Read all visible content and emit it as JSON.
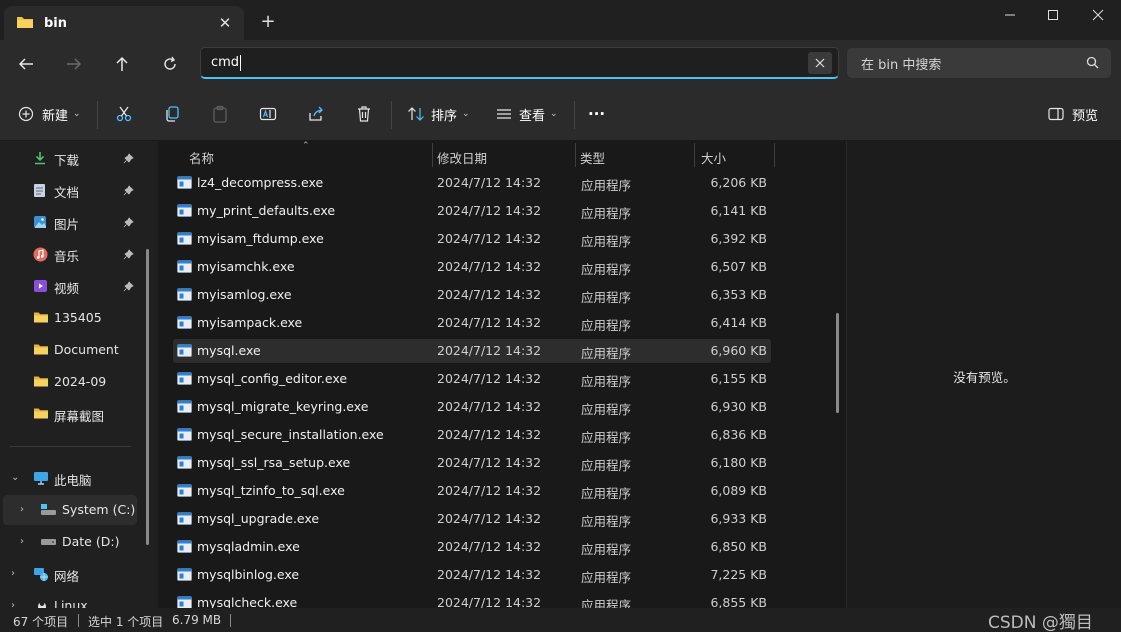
{
  "window": {
    "tab_title": "bin",
    "new_tab_symbol": "+",
    "close_symbol": "✕"
  },
  "address": {
    "value": "cmd",
    "search_placeholder": "在 bin 中搜索"
  },
  "toolbar": {
    "new_label": "新建",
    "sort_label": "排序",
    "view_label": "查看",
    "more_label": "···",
    "preview_label": "预览"
  },
  "sidebar": {
    "items": [
      {
        "label": "下载",
        "icon": "download-icon",
        "pinned": true
      },
      {
        "label": "文档",
        "icon": "document-icon",
        "pinned": true
      },
      {
        "label": "图片",
        "icon": "pictures-icon",
        "pinned": true
      },
      {
        "label": "音乐",
        "icon": "music-icon",
        "pinned": true
      },
      {
        "label": "视频",
        "icon": "videos-icon",
        "pinned": true
      },
      {
        "label": "135405",
        "icon": "folder-icon"
      },
      {
        "label": "Document",
        "icon": "folder-icon"
      },
      {
        "label": "2024-09",
        "icon": "folder-icon"
      },
      {
        "label": "屏幕截图",
        "icon": "folder-icon"
      }
    ],
    "tree": [
      {
        "label": "此电脑",
        "icon": "pc-icon"
      },
      {
        "label": "System (C:)",
        "icon": "drive-icon"
      },
      {
        "label": "Date (D:)",
        "icon": "drive-icon"
      },
      {
        "label": "网络",
        "icon": "network-icon"
      },
      {
        "label": "Linux",
        "icon": "linux-icon"
      }
    ]
  },
  "columns": {
    "name": "名称",
    "date": "修改日期",
    "type": "类型",
    "size": "大小"
  },
  "files": [
    {
      "name": "lz4_decompress.exe",
      "date": "2024/7/12 14:32",
      "type": "应用程序",
      "size": "6,206 KB"
    },
    {
      "name": "my_print_defaults.exe",
      "date": "2024/7/12 14:32",
      "type": "应用程序",
      "size": "6,141 KB"
    },
    {
      "name": "myisam_ftdump.exe",
      "date": "2024/7/12 14:32",
      "type": "应用程序",
      "size": "6,392 KB"
    },
    {
      "name": "myisamchk.exe",
      "date": "2024/7/12 14:32",
      "type": "应用程序",
      "size": "6,507 KB"
    },
    {
      "name": "myisamlog.exe",
      "date": "2024/7/12 14:32",
      "type": "应用程序",
      "size": "6,353 KB"
    },
    {
      "name": "myisampack.exe",
      "date": "2024/7/12 14:32",
      "type": "应用程序",
      "size": "6,414 KB"
    },
    {
      "name": "mysql.exe",
      "date": "2024/7/12 14:32",
      "type": "应用程序",
      "size": "6,960 KB"
    },
    {
      "name": "mysql_config_editor.exe",
      "date": "2024/7/12 14:32",
      "type": "应用程序",
      "size": "6,155 KB"
    },
    {
      "name": "mysql_migrate_keyring.exe",
      "date": "2024/7/12 14:32",
      "type": "应用程序",
      "size": "6,930 KB"
    },
    {
      "name": "mysql_secure_installation.exe",
      "date": "2024/7/12 14:32",
      "type": "应用程序",
      "size": "6,836 KB"
    },
    {
      "name": "mysql_ssl_rsa_setup.exe",
      "date": "2024/7/12 14:32",
      "type": "应用程序",
      "size": "6,180 KB"
    },
    {
      "name": "mysql_tzinfo_to_sql.exe",
      "date": "2024/7/12 14:32",
      "type": "应用程序",
      "size": "6,089 KB"
    },
    {
      "name": "mysql_upgrade.exe",
      "date": "2024/7/12 14:32",
      "type": "应用程序",
      "size": "6,933 KB"
    },
    {
      "name": "mysqladmin.exe",
      "date": "2024/7/12 14:32",
      "type": "应用程序",
      "size": "6,850 KB"
    },
    {
      "name": "mysqlbinlog.exe",
      "date": "2024/7/12 14:32",
      "type": "应用程序",
      "size": "7,225 KB"
    },
    {
      "name": "mysqlcheck.exe",
      "date": "2024/7/12 14:32",
      "type": "应用程序",
      "size": "6,855 KB"
    }
  ],
  "selected_file": "mysql.exe",
  "preview": {
    "empty_text": "没有预览。"
  },
  "status": {
    "item_count": "67 个项目",
    "selection": "选中 1 个项目",
    "selection_size": "6.79 MB",
    "watermark": "CSDN @獨目"
  },
  "colors": {
    "accent": "#4cc2ff",
    "folder": "#f0c24c",
    "background": "#191919"
  }
}
